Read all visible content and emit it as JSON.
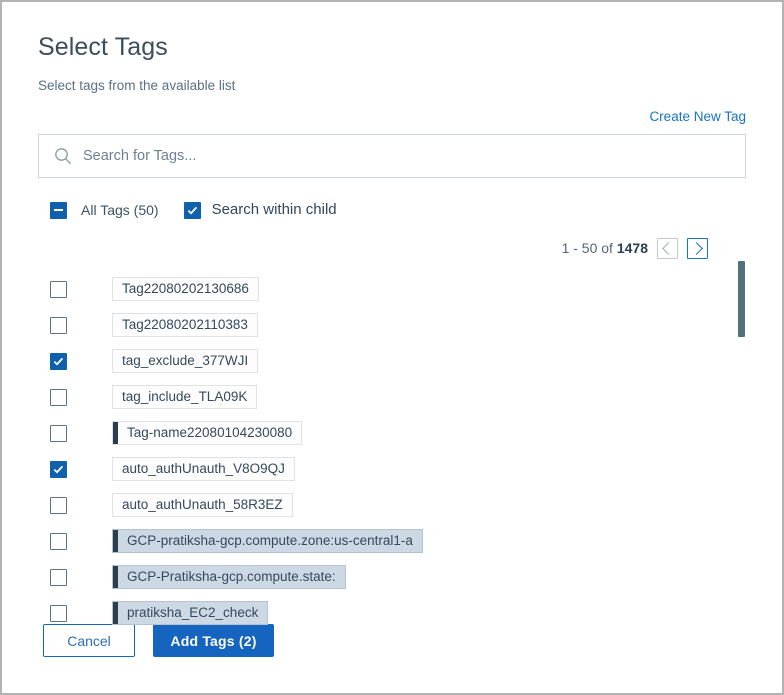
{
  "dialog": {
    "title": "Select Tags",
    "subtitle": "Select tags from the available list",
    "create_link": "Create New Tag"
  },
  "search": {
    "placeholder": "Search for Tags...",
    "value": "",
    "icon": "search-icon"
  },
  "filters": {
    "all_tags_label": "All Tags (50)",
    "all_tags_state": "indeterminate",
    "search_within_child_label": "Search within child",
    "search_within_child_state": "checked"
  },
  "pagination": {
    "range": "1 - 50 of",
    "total": "1478",
    "prev_icon": "chevron-left-icon",
    "next_icon": "chevron-right-icon",
    "prev_enabled": false,
    "next_enabled": true
  },
  "tags": [
    {
      "label": "Tag22080202130686",
      "checked": false,
      "bar": false,
      "colored": false
    },
    {
      "label": "Tag22080202110383",
      "checked": false,
      "bar": false,
      "colored": false
    },
    {
      "label": "tag_exclude_377WJI",
      "checked": true,
      "bar": false,
      "colored": false
    },
    {
      "label": "tag_include_TLA09K",
      "checked": false,
      "bar": false,
      "colored": false
    },
    {
      "label": "Tag-name22080104230080",
      "checked": false,
      "bar": true,
      "colored": false
    },
    {
      "label": "auto_authUnauth_V8O9QJ",
      "checked": true,
      "bar": false,
      "colored": false
    },
    {
      "label": "auto_authUnauth_58R3EZ",
      "checked": false,
      "bar": false,
      "colored": false
    },
    {
      "label": "GCP-pratiksha-gcp.compute.zone:us-central1-a",
      "checked": false,
      "bar": true,
      "colored": true
    },
    {
      "label": "GCP-Pratiksha-gcp.compute.state:",
      "checked": false,
      "bar": true,
      "colored": true
    },
    {
      "label": "pratiksha_EC2_check",
      "checked": false,
      "bar": true,
      "colored": true
    }
  ],
  "footer": {
    "cancel_label": "Cancel",
    "submit_label": "Add Tags (2)"
  },
  "colors": {
    "accent_blue": "#1565c0",
    "link_blue": "#1a73c4",
    "checkbox_blue": "#1061ac",
    "title_slate": "#3c4d5c",
    "chip_selected_bg": "#ccd9e4",
    "tag_bar": "#2c3e4e",
    "scrollbar_thumb": "#52707f"
  }
}
